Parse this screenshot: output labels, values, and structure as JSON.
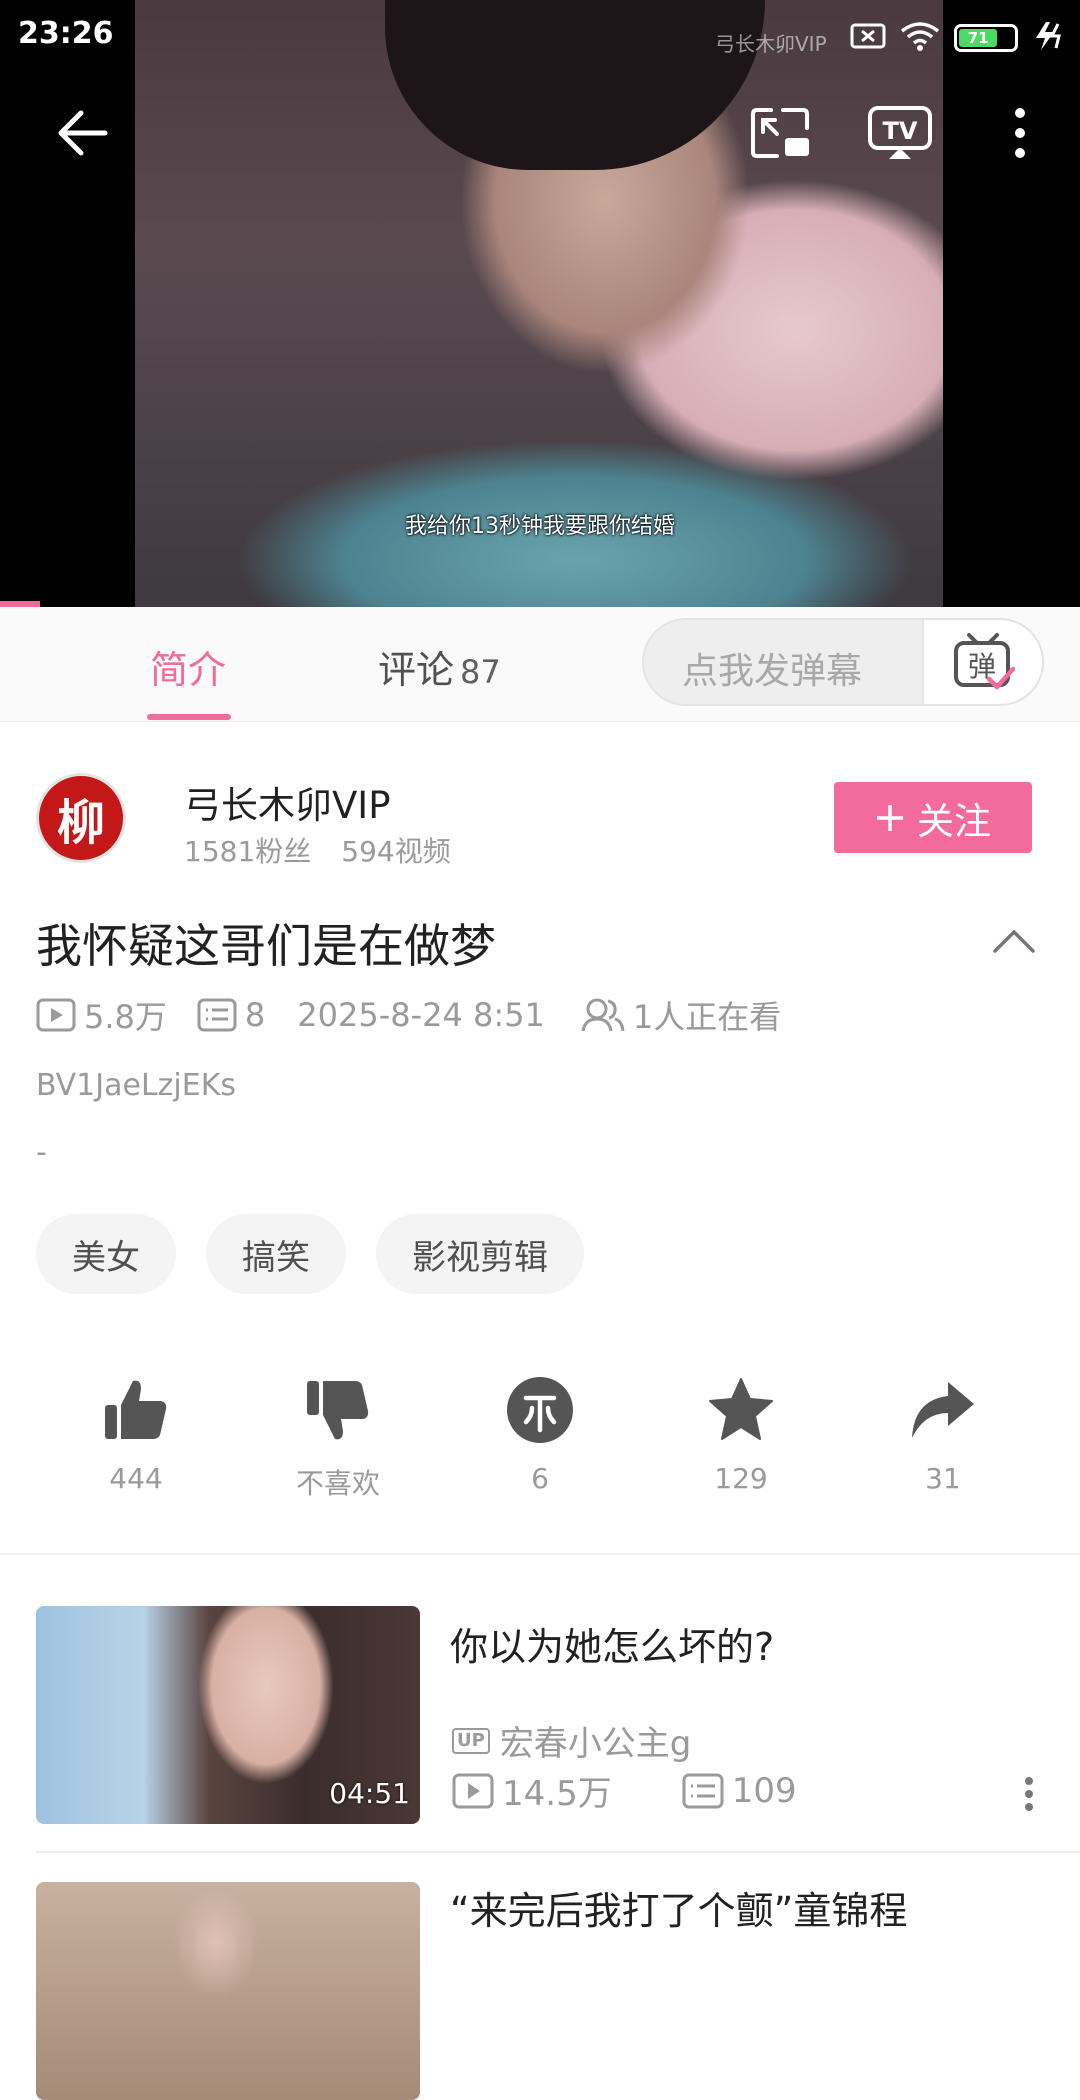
{
  "status_bar": {
    "time": "23:26",
    "battery_level": "71",
    "icons": [
      "sim-x-icon",
      "wifi-icon",
      "battery-icon",
      "charging-icon"
    ]
  },
  "player": {
    "watermark": "弓长木卯VIP",
    "subtitle": "我给你13秒钟我要跟你结婚",
    "progress_fraction": 0.037
  },
  "tabs": {
    "intro_label": "简介",
    "comments_label": "评论",
    "comments_count": "87",
    "danmaku_placeholder": "点我发弹幕",
    "danmaku_icon_text": "弹"
  },
  "uploader": {
    "avatar_char": "柳",
    "name": "弓长木卯VIP",
    "fans": "1581粉丝",
    "videos": "594视频",
    "follow_label": "关注"
  },
  "video": {
    "title": "我怀疑这哥们是在做梦",
    "views": "5.8万",
    "danmaku_count": "8",
    "date": "2025-8-24 8:51",
    "watching": "1人正在看",
    "bvid": "BV1JaeLzjEKs",
    "description": "-"
  },
  "tags": [
    "美女",
    "搞笑",
    "影视剪辑"
  ],
  "actions": {
    "like": "444",
    "dislike": "不喜欢",
    "coin": "6",
    "favorite": "129",
    "share": "31"
  },
  "recommendations": [
    {
      "title": "你以为她怎么坏的?",
      "duration": "04:51",
      "up_badge": "UP",
      "uploader": "宏春小公主g",
      "views": "14.5万",
      "danmaku": "109"
    },
    {
      "title": "“来完后我打了个颤”童锦程"
    }
  ],
  "colors": {
    "accent": "#f26b9b",
    "text_primary": "#212121",
    "text_secondary": "#9a9a9a"
  }
}
